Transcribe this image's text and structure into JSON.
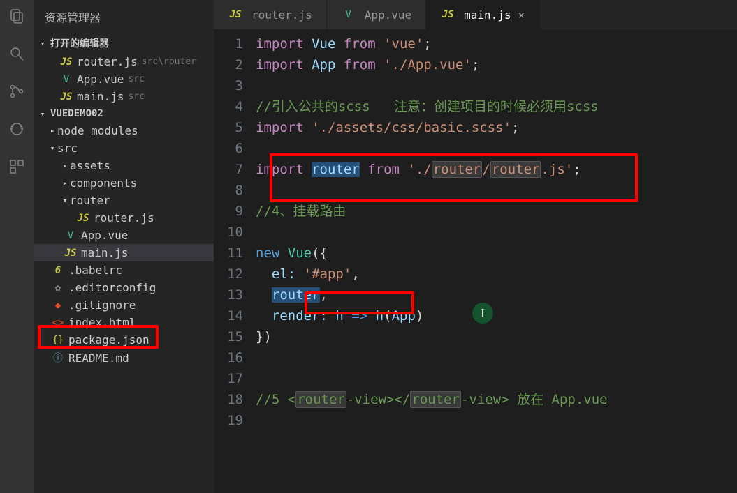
{
  "sidebar": {
    "title": "资源管理器",
    "open_editors_label": "打开的编辑器",
    "project_label": "VUEDEMO02",
    "open_editors": [
      {
        "icon": "js",
        "name": "router.js",
        "hint": "src\\router"
      },
      {
        "icon": "vue",
        "name": "App.vue",
        "hint": "src"
      },
      {
        "icon": "js",
        "name": "main.js",
        "hint": "src"
      }
    ],
    "tree": {
      "node_modules": "node_modules",
      "src": "src",
      "assets": "assets",
      "components": "components",
      "router_folder": "router",
      "router_js": "router.js",
      "app_vue": "App.vue",
      "main_js": "main.js",
      "babelrc": ".babelrc",
      "editorconfig": ".editorconfig",
      "gitignore": ".gitignore",
      "index_html": "index.html",
      "package_json": "package.json",
      "readme": "README.md"
    }
  },
  "tabs": [
    {
      "icon": "js",
      "name": "router.js"
    },
    {
      "icon": "vue",
      "name": "App.vue"
    },
    {
      "icon": "js",
      "name": "main.js",
      "active": true
    }
  ],
  "code": {
    "lines": [
      {
        "n": 1,
        "t": [
          {
            "c": "kw",
            "s": "import"
          },
          {
            "c": "punct",
            "s": " "
          },
          {
            "c": "ident",
            "s": "Vue"
          },
          {
            "c": "punct",
            "s": " "
          },
          {
            "c": "kw",
            "s": "from"
          },
          {
            "c": "punct",
            "s": " "
          },
          {
            "c": "str",
            "s": "'vue'"
          },
          {
            "c": "punct",
            "s": ";"
          }
        ]
      },
      {
        "n": 2,
        "t": [
          {
            "c": "kw",
            "s": "import"
          },
          {
            "c": "punct",
            "s": " "
          },
          {
            "c": "ident",
            "s": "App"
          },
          {
            "c": "punct",
            "s": " "
          },
          {
            "c": "kw",
            "s": "from"
          },
          {
            "c": "punct",
            "s": " "
          },
          {
            "c": "str",
            "s": "'./App.vue'"
          },
          {
            "c": "punct",
            "s": ";"
          }
        ]
      },
      {
        "n": 3,
        "t": []
      },
      {
        "n": 4,
        "t": [
          {
            "c": "cmt",
            "s": "//引入公共的scss   注意：创建项目的时候必须用scss"
          }
        ]
      },
      {
        "n": 5,
        "t": [
          {
            "c": "kw",
            "s": "import"
          },
          {
            "c": "punct",
            "s": " "
          },
          {
            "c": "str",
            "s": "'./assets/css/basic.scss'"
          },
          {
            "c": "punct",
            "s": ";"
          }
        ]
      },
      {
        "n": 6,
        "t": []
      },
      {
        "n": 7,
        "t": [
          {
            "c": "kw",
            "s": "import"
          },
          {
            "c": "punct",
            "s": " "
          },
          {
            "c": "ident hl",
            "s": "router"
          },
          {
            "c": "punct",
            "s": " "
          },
          {
            "c": "kw",
            "s": "from"
          },
          {
            "c": "punct",
            "s": " "
          },
          {
            "c": "str",
            "s": "'./"
          },
          {
            "c": "str dimhl",
            "s": "router"
          },
          {
            "c": "str",
            "s": "/"
          },
          {
            "c": "str dimhl",
            "s": "router"
          },
          {
            "c": "str",
            "s": ".js'"
          },
          {
            "c": "punct",
            "s": ";"
          }
        ]
      },
      {
        "n": 8,
        "t": []
      },
      {
        "n": 9,
        "t": [
          {
            "c": "cmt",
            "s": "//4、挂载路由"
          }
        ]
      },
      {
        "n": 10,
        "t": []
      },
      {
        "n": 11,
        "t": [
          {
            "c": "op",
            "s": "new"
          },
          {
            "c": "punct",
            "s": " "
          },
          {
            "c": "cls",
            "s": "Vue"
          },
          {
            "c": "punct",
            "s": "({"
          }
        ]
      },
      {
        "n": 12,
        "t": [
          {
            "c": "guide",
            "s": "  "
          },
          {
            "c": "ident",
            "s": "el:"
          },
          {
            "c": "punct",
            "s": " "
          },
          {
            "c": "str",
            "s": "'#app'"
          },
          {
            "c": "punct",
            "s": ","
          }
        ]
      },
      {
        "n": 13,
        "t": [
          {
            "c": "guide",
            "s": "  "
          },
          {
            "c": "ident hl",
            "s": "router"
          },
          {
            "c": "punct",
            "s": ","
          }
        ]
      },
      {
        "n": 14,
        "t": [
          {
            "c": "guide",
            "s": "  "
          },
          {
            "c": "ident",
            "s": "render:"
          },
          {
            "c": "punct",
            "s": " "
          },
          {
            "c": "ident",
            "s": "h"
          },
          {
            "c": "punct",
            "s": " "
          },
          {
            "c": "op",
            "s": "=>"
          },
          {
            "c": "punct",
            "s": " "
          },
          {
            "c": "ident",
            "s": "h"
          },
          {
            "c": "punct",
            "s": "("
          },
          {
            "c": "ident",
            "s": "App"
          },
          {
            "c": "punct",
            "s": ")"
          }
        ]
      },
      {
        "n": 15,
        "t": [
          {
            "c": "punct",
            "s": "})"
          }
        ]
      },
      {
        "n": 16,
        "t": []
      },
      {
        "n": 17,
        "t": []
      },
      {
        "n": 18,
        "t": [
          {
            "c": "cmt",
            "s": "//5 <"
          },
          {
            "c": "cmt dimhl",
            "s": "router"
          },
          {
            "c": "cmt",
            "s": "-view></"
          },
          {
            "c": "cmt dimhl",
            "s": "router"
          },
          {
            "c": "cmt",
            "s": "-view> 放在 App.vue"
          }
        ]
      },
      {
        "n": 19,
        "t": []
      }
    ]
  }
}
